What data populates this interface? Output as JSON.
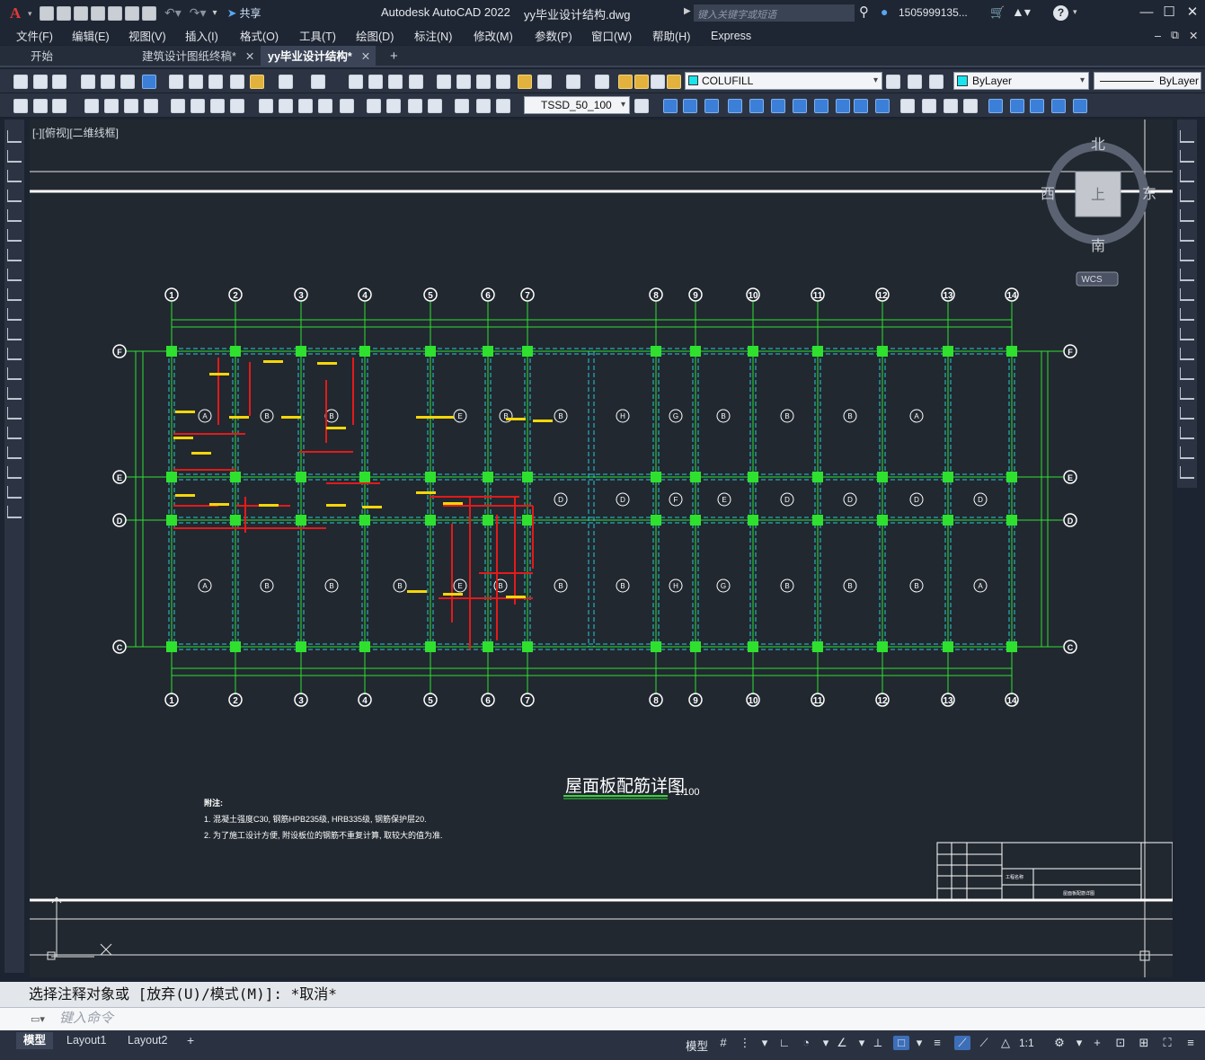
{
  "titlebar": {
    "app_name": "Autodesk AutoCAD 2022",
    "file_name": "yy毕业设计结构.dwg",
    "share_label": "共享",
    "search_placeholder": "键入关键字或短语",
    "user": "1505999135...",
    "min": "—",
    "max": "☐",
    "close": "✕"
  },
  "menubar": [
    "文件(F)",
    "编辑(E)",
    "视图(V)",
    "插入(I)",
    "格式(O)",
    "工具(T)",
    "绘图(D)",
    "标注(N)",
    "修改(M)",
    "参数(P)",
    "窗口(W)",
    "帮助(H)",
    "Express"
  ],
  "tabs": {
    "start": "开始",
    "doc1": "建筑设计图纸终稿*",
    "doc2": "yy毕业设计结构*",
    "add": "+"
  },
  "toolbar": {
    "layer_value": "COLUFILL",
    "color_value": "ByLayer",
    "linetype_value": "ByLayer",
    "dimstyle_value": "TSSD_50_100"
  },
  "view": {
    "label": "[-][俯视][二维线框]",
    "viewcube": {
      "north": "北",
      "south": "南",
      "east": "东",
      "west": "西",
      "top": "上",
      "wcs": "WCS"
    }
  },
  "drawing": {
    "title": "屋面板配筋详图",
    "scale": "1:100",
    "notes_heading": "附注:",
    "note1": "1. 混凝土强度C30, 钢筋HPB235级, HRB335级, 钢筋保护层20.",
    "note2": "2. 为了施工设计方便, 附设板位的钢筋不重复计算, 取较大的值为准.",
    "axis_numbers": [
      "1",
      "2",
      "3",
      "4",
      "5",
      "6",
      "7",
      "8",
      "9",
      "10",
      "11",
      "12",
      "13",
      "14"
    ],
    "axis_letters": [
      "F",
      "E",
      "D",
      "C"
    ],
    "slab_codes_row1": [
      "A",
      "B",
      "B",
      "E",
      "B",
      "B",
      "H",
      "G",
      "B",
      "B",
      "B",
      "A"
    ],
    "slab_codes_row2": [
      "D",
      "D",
      "F",
      "E",
      "D",
      "D",
      "D",
      "D"
    ],
    "slab_codes_row3": [
      "A",
      "B",
      "B",
      "B",
      "E",
      "B",
      "B",
      "B",
      "H",
      "G",
      "B",
      "B",
      "B",
      "A"
    ],
    "titleblock_left": "工程名称",
    "titleblock_title": "屋面板配筋详图"
  },
  "command": {
    "history": "选择注释对象或 [放弃(U)/模式(M)]: *取消*",
    "placeholder": "键入命令"
  },
  "status": {
    "model_tab": "模型",
    "layout1": "Layout1",
    "layout2": "Layout2",
    "add": "+",
    "model_btn": "模型",
    "scale": "1:1"
  }
}
